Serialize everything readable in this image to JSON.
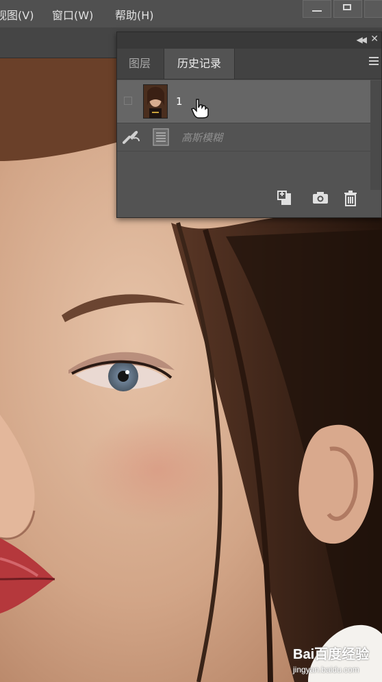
{
  "menubar": {
    "items": [
      {
        "label": "视图(V)"
      },
      {
        "label": "窗口(W)"
      },
      {
        "label": "帮助(H)"
      }
    ]
  },
  "history_panel": {
    "tabs": [
      {
        "label": "图层",
        "active": false
      },
      {
        "label": "历史记录",
        "active": true
      }
    ],
    "snapshot": {
      "label": "1"
    },
    "states": [
      {
        "label": "高斯模糊",
        "icon": "document-state-icon"
      }
    ],
    "icons": {
      "collapse": "double-chevron-left-icon",
      "close": "close-icon",
      "menu": "panel-menu-icon",
      "bottom": [
        "new-document-from-state-icon",
        "camera-snapshot-icon",
        "trash-icon"
      ]
    }
  },
  "watermark": {
    "brand": "Bai百度经验",
    "url": "jingyan.baidu.com"
  },
  "colors": {
    "menubar": "#505050",
    "panel": "#535353",
    "selected_row": "#666666",
    "skin": "#c89b7a",
    "hair": "#3a2418"
  }
}
